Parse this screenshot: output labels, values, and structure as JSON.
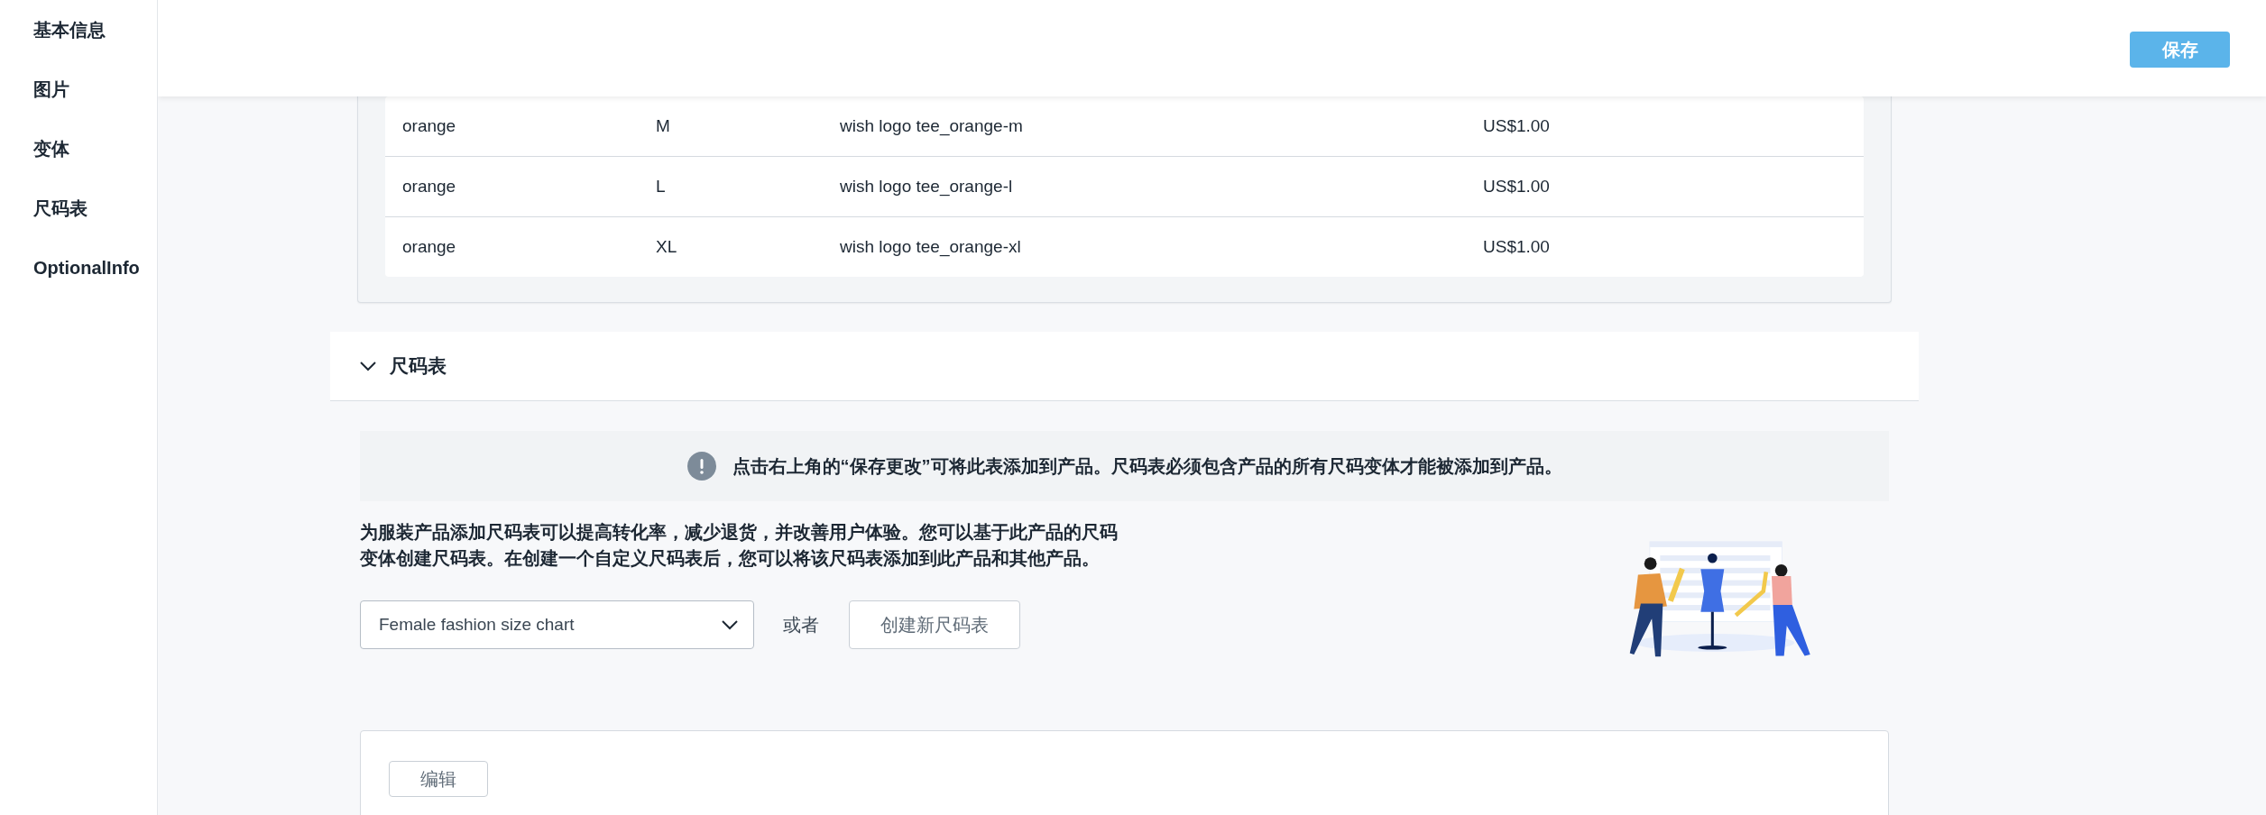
{
  "sidebar": {
    "items": [
      {
        "label": "基本信息"
      },
      {
        "label": "图片"
      },
      {
        "label": "变体"
      },
      {
        "label": "尺码表"
      },
      {
        "label": "OptionalInfo"
      }
    ]
  },
  "header": {
    "save_button": "保存"
  },
  "variants_table": {
    "rows": [
      {
        "cells": [
          "orange",
          "M",
          "wish logo tee_orange-m",
          "US$1.00"
        ]
      },
      {
        "cells": [
          "orange",
          "L",
          "wish logo tee_orange-l",
          "US$1.00"
        ]
      },
      {
        "cells": [
          "orange",
          "XL",
          "wish logo tee_orange-xl",
          "US$1.00"
        ]
      }
    ]
  },
  "size_chart_section": {
    "title": "尺码表",
    "expanded": true,
    "notice": "点击右上角的“保存更改”可将此表添加到产品。尺码表必须包含产品的所有尺码变体才能被添加到产品。",
    "description": "为服装产品添加尺码表可以提高转化率，减少退货，并改善用户体验。您可以基于此产品的尺码变体创建尺码表。在创建一个自定义尺码表后，您可以将该尺码表添加到此产品和其他产品。",
    "select": {
      "value": "Female fashion size chart"
    },
    "or_label": "或者",
    "create_button": "创建新尺码表",
    "edit_button": "编辑"
  }
}
